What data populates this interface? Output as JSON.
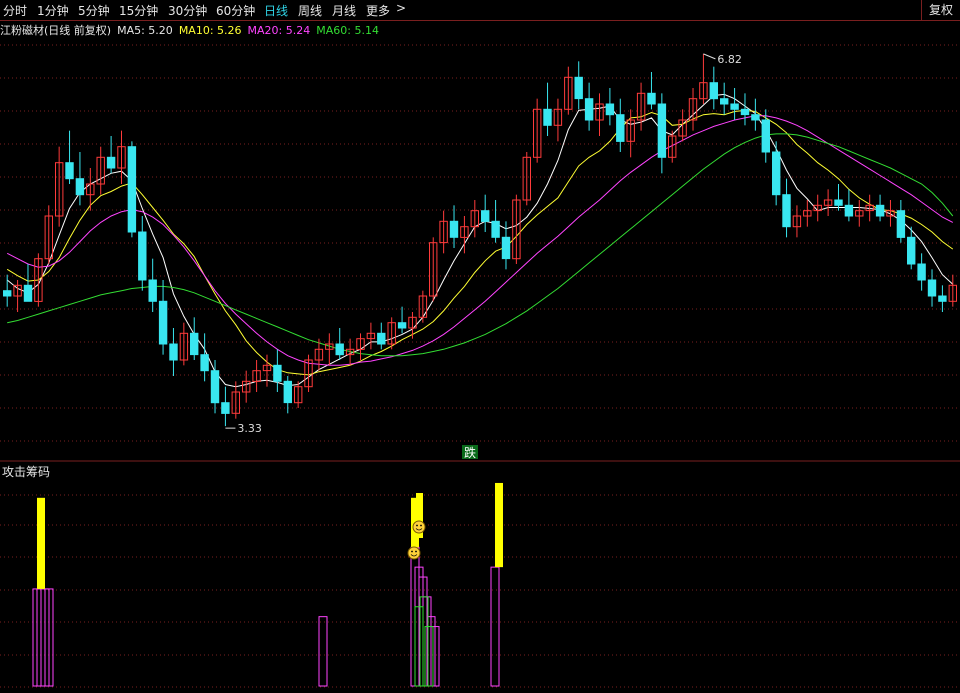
{
  "toolbar": {
    "tabs": [
      "分时",
      "1分钟",
      "5分钟",
      "15分钟",
      "30分钟",
      "60分钟",
      "日线",
      "周线",
      "月线",
      "更多"
    ],
    "active_tab": "日线",
    "more_arrow": ">",
    "restore_button": "复权"
  },
  "legend": {
    "stock_name": "江粉磁材(日线 前复权)",
    "ma5_label": "MA5: 5.20",
    "ma10_label": "MA10: 5.26",
    "ma20_label": "MA20: 5.24",
    "ma60_label": "MA60: 5.14"
  },
  "colors": {
    "up": "#ff3b3b",
    "down": "#39e6f0",
    "ma5": "#ffffff",
    "ma10": "#ffff33",
    "ma20": "#ff44ff",
    "ma60": "#33dd33",
    "grid": "#7a1f1f"
  },
  "chart_data": [
    {
      "type": "candlestick",
      "title": "江粉磁材(日线 前复权)",
      "ylim": [
        3.2,
        6.95
      ],
      "high_annotation": "6.82",
      "low_annotation": "3.33",
      "marker_label": "跌",
      "ohlc": [
        [
          4.6,
          4.75,
          4.45,
          4.55
        ],
        [
          4.55,
          4.7,
          4.4,
          4.65
        ],
        [
          4.65,
          4.85,
          4.55,
          4.5
        ],
        [
          4.5,
          4.95,
          4.45,
          4.9
        ],
        [
          4.9,
          5.4,
          4.85,
          5.3
        ],
        [
          5.3,
          5.95,
          5.2,
          5.8
        ],
        [
          5.8,
          6.1,
          5.6,
          5.65
        ],
        [
          5.65,
          5.9,
          5.4,
          5.5
        ],
        [
          5.5,
          5.75,
          5.35,
          5.6
        ],
        [
          5.6,
          5.95,
          5.5,
          5.85
        ],
        [
          5.85,
          6.05,
          5.7,
          5.75
        ],
        [
          5.75,
          6.1,
          5.6,
          5.95
        ],
        [
          5.95,
          6.0,
          5.1,
          5.15
        ],
        [
          5.15,
          5.3,
          4.6,
          4.7
        ],
        [
          4.7,
          4.9,
          4.4,
          4.5
        ],
        [
          4.5,
          4.7,
          4.0,
          4.1
        ],
        [
          4.1,
          4.25,
          3.8,
          3.95
        ],
        [
          3.95,
          4.3,
          3.9,
          4.2
        ],
        [
          4.2,
          4.35,
          3.95,
          4.0
        ],
        [
          4.0,
          4.2,
          3.75,
          3.85
        ],
        [
          3.85,
          3.95,
          3.45,
          3.55
        ],
        [
          3.55,
          3.7,
          3.33,
          3.45
        ],
        [
          3.45,
          3.75,
          3.4,
          3.65
        ],
        [
          3.65,
          3.85,
          3.55,
          3.75
        ],
        [
          3.75,
          3.95,
          3.65,
          3.85
        ],
        [
          3.85,
          4.0,
          3.7,
          3.9
        ],
        [
          3.9,
          4.05,
          3.65,
          3.75
        ],
        [
          3.75,
          3.8,
          3.45,
          3.55
        ],
        [
          3.55,
          3.75,
          3.5,
          3.7
        ],
        [
          3.7,
          4.0,
          3.65,
          3.95
        ],
        [
          3.95,
          4.15,
          3.85,
          4.05
        ],
        [
          4.05,
          4.2,
          3.9,
          4.1
        ],
        [
          4.1,
          4.25,
          3.95,
          4.0
        ],
        [
          4.0,
          4.15,
          3.9,
          4.05
        ],
        [
          4.05,
          4.2,
          3.95,
          4.15
        ],
        [
          4.15,
          4.3,
          4.05,
          4.2
        ],
        [
          4.2,
          4.3,
          4.05,
          4.1
        ],
        [
          4.1,
          4.35,
          4.05,
          4.3
        ],
        [
          4.3,
          4.45,
          4.2,
          4.25
        ],
        [
          4.25,
          4.4,
          4.15,
          4.35
        ],
        [
          4.35,
          4.6,
          4.3,
          4.55
        ],
        [
          4.55,
          5.1,
          4.5,
          5.05
        ],
        [
          5.05,
          5.35,
          4.95,
          5.25
        ],
        [
          5.25,
          5.4,
          5.0,
          5.1
        ],
        [
          5.1,
          5.3,
          4.95,
          5.2
        ],
        [
          5.2,
          5.45,
          5.1,
          5.35
        ],
        [
          5.35,
          5.5,
          5.15,
          5.25
        ],
        [
          5.25,
          5.45,
          5.05,
          5.1
        ],
        [
          5.1,
          5.25,
          4.8,
          4.9
        ],
        [
          4.9,
          5.5,
          4.85,
          5.45
        ],
        [
          5.45,
          5.9,
          5.4,
          5.85
        ],
        [
          5.85,
          6.4,
          5.8,
          6.3
        ],
        [
          6.3,
          6.55,
          6.05,
          6.15
        ],
        [
          6.15,
          6.4,
          6.0,
          6.3
        ],
        [
          6.3,
          6.7,
          6.25,
          6.6
        ],
        [
          6.6,
          6.75,
          6.3,
          6.4
        ],
        [
          6.4,
          6.55,
          6.1,
          6.2
        ],
        [
          6.2,
          6.45,
          6.05,
          6.35
        ],
        [
          6.35,
          6.5,
          6.15,
          6.25
        ],
        [
          6.25,
          6.4,
          5.9,
          6.0
        ],
        [
          6.0,
          6.3,
          5.85,
          6.2
        ],
        [
          6.2,
          6.55,
          6.1,
          6.45
        ],
        [
          6.45,
          6.65,
          6.3,
          6.35
        ],
        [
          6.35,
          6.45,
          5.7,
          5.85
        ],
        [
          5.85,
          6.1,
          5.8,
          6.05
        ],
        [
          6.05,
          6.3,
          6.0,
          6.2
        ],
        [
          6.2,
          6.5,
          6.1,
          6.4
        ],
        [
          6.4,
          6.82,
          6.35,
          6.55
        ],
        [
          6.55,
          6.7,
          6.3,
          6.4
        ],
        [
          6.4,
          6.55,
          6.25,
          6.35
        ],
        [
          6.35,
          6.5,
          6.2,
          6.3
        ],
        [
          6.3,
          6.45,
          6.15,
          6.25
        ],
        [
          6.25,
          6.4,
          6.1,
          6.2
        ],
        [
          6.2,
          6.3,
          5.8,
          5.9
        ],
        [
          5.9,
          6.0,
          5.4,
          5.5
        ],
        [
          5.5,
          5.65,
          5.1,
          5.2
        ],
        [
          5.2,
          5.4,
          5.1,
          5.3
        ],
        [
          5.3,
          5.45,
          5.2,
          5.35
        ],
        [
          5.35,
          5.5,
          5.25,
          5.4
        ],
        [
          5.4,
          5.55,
          5.3,
          5.45
        ],
        [
          5.45,
          5.6,
          5.35,
          5.4
        ],
        [
          5.4,
          5.55,
          5.25,
          5.3
        ],
        [
          5.3,
          5.45,
          5.2,
          5.35
        ],
        [
          5.35,
          5.5,
          5.25,
          5.4
        ],
        [
          5.4,
          5.5,
          5.25,
          5.3
        ],
        [
          5.3,
          5.45,
          5.2,
          5.35
        ],
        [
          5.35,
          5.45,
          5.05,
          5.1
        ],
        [
          5.1,
          5.2,
          4.8,
          4.85
        ],
        [
          4.85,
          4.95,
          4.6,
          4.7
        ],
        [
          4.7,
          4.8,
          4.45,
          4.55
        ],
        [
          4.55,
          4.65,
          4.4,
          4.5
        ],
        [
          4.5,
          4.75,
          4.45,
          4.65
        ]
      ],
      "series": [
        {
          "name": "MA5",
          "values": [
            4.7,
            4.62,
            4.58,
            4.66,
            4.86,
            5.12,
            5.37,
            5.52,
            5.6,
            5.65,
            5.7,
            5.72,
            5.63,
            5.37,
            5.13,
            4.91,
            4.57,
            4.36,
            4.19,
            4.05,
            3.84,
            3.72,
            3.7,
            3.72,
            3.75,
            3.76,
            3.74,
            3.71,
            3.72,
            3.79,
            3.86,
            3.91,
            3.96,
            4.01,
            4.05,
            4.12,
            4.12,
            4.15,
            4.19,
            4.24,
            4.35,
            4.51,
            4.7,
            4.88,
            5.04,
            5.2,
            5.25,
            5.23,
            5.18,
            5.21,
            5.29,
            5.42,
            5.6,
            5.82,
            6.11,
            6.29,
            6.3,
            6.31,
            6.33,
            6.2,
            6.16,
            6.18,
            6.22,
            6.1,
            6.06,
            6.16,
            6.25,
            6.34,
            6.43,
            6.44,
            6.4,
            6.33,
            6.26,
            6.11,
            5.93,
            5.73,
            5.56,
            5.46,
            5.35,
            5.38,
            5.38,
            5.38,
            5.38,
            5.37,
            5.36,
            5.32,
            5.26,
            5.17,
            5.06,
            4.91,
            4.75,
            4.66
          ]
        },
        {
          "name": "MA10",
          "values": [
            4.8,
            4.74,
            4.69,
            4.7,
            4.78,
            4.91,
            5.09,
            5.26,
            5.4,
            5.49,
            5.53,
            5.58,
            5.61,
            5.5,
            5.38,
            5.26,
            5.13,
            5.04,
            4.92,
            4.74,
            4.57,
            4.41,
            4.28,
            4.13,
            4.02,
            3.93,
            3.86,
            3.83,
            3.82,
            3.81,
            3.84,
            3.86,
            3.88,
            3.9,
            3.94,
            3.99,
            4.03,
            4.08,
            4.14,
            4.19,
            4.24,
            4.31,
            4.41,
            4.53,
            4.64,
            4.77,
            4.88,
            4.97,
            5.01,
            5.11,
            5.22,
            5.31,
            5.39,
            5.47,
            5.62,
            5.77,
            5.85,
            5.91,
            6.0,
            6.12,
            6.22,
            6.23,
            6.27,
            6.24,
            6.15,
            6.16,
            6.21,
            6.25,
            6.26,
            6.25,
            6.28,
            6.29,
            6.28,
            6.22,
            6.16,
            6.08,
            5.97,
            5.89,
            5.8,
            5.73,
            5.65,
            5.55,
            5.47,
            5.41,
            5.36,
            5.35,
            5.32,
            5.28,
            5.22,
            5.15,
            5.06,
            4.99
          ]
        },
        {
          "name": "MA20",
          "values": [
            4.95,
            4.9,
            4.85,
            4.82,
            4.83,
            4.88,
            4.96,
            5.06,
            5.16,
            5.24,
            5.3,
            5.34,
            5.36,
            5.34,
            5.29,
            5.22,
            5.12,
            5.01,
            4.88,
            4.74,
            4.6,
            4.48,
            4.38,
            4.29,
            4.2,
            4.12,
            4.05,
            3.99,
            3.95,
            3.92,
            3.91,
            3.9,
            3.9,
            3.91,
            3.93,
            3.94,
            3.96,
            3.98,
            4.01,
            4.04,
            4.08,
            4.13,
            4.19,
            4.26,
            4.34,
            4.42,
            4.5,
            4.59,
            4.68,
            4.77,
            4.86,
            4.95,
            5.03,
            5.11,
            5.2,
            5.29,
            5.37,
            5.45,
            5.54,
            5.63,
            5.71,
            5.78,
            5.85,
            5.91,
            5.96,
            6.01,
            6.06,
            6.1,
            6.14,
            6.17,
            6.2,
            6.22,
            6.24,
            6.24,
            6.22,
            6.19,
            6.15,
            6.1,
            6.04,
            5.98,
            5.92,
            5.86,
            5.8,
            5.74,
            5.68,
            5.62,
            5.56,
            5.5,
            5.43,
            5.36,
            5.29,
            5.24
          ]
        },
        {
          "name": "MA60",
          "values": [
            4.3,
            4.32,
            4.35,
            4.38,
            4.41,
            4.44,
            4.47,
            4.5,
            4.53,
            4.56,
            4.58,
            4.6,
            4.62,
            4.63,
            4.64,
            4.64,
            4.63,
            4.61,
            4.58,
            4.54,
            4.5,
            4.46,
            4.42,
            4.38,
            4.34,
            4.3,
            4.26,
            4.22,
            4.18,
            4.14,
            4.11,
            4.08,
            4.05,
            4.03,
            4.01,
            4.0,
            3.99,
            3.99,
            3.99,
            4.0,
            4.01,
            4.03,
            4.05,
            4.08,
            4.11,
            4.15,
            4.19,
            4.24,
            4.29,
            4.35,
            4.41,
            4.48,
            4.55,
            4.62,
            4.7,
            4.78,
            4.86,
            4.94,
            5.02,
            5.1,
            5.18,
            5.26,
            5.34,
            5.42,
            5.5,
            5.58,
            5.66,
            5.74,
            5.81,
            5.88,
            5.94,
            5.99,
            6.03,
            6.06,
            6.07,
            6.07,
            6.06,
            6.04,
            6.01,
            5.98,
            5.95,
            5.91,
            5.87,
            5.83,
            5.79,
            5.75,
            5.7,
            5.65,
            5.6,
            5.52,
            5.42,
            5.3
          ]
        }
      ]
    },
    {
      "type": "bar",
      "title": "攻击筹码",
      "groups": [
        {
          "magenta": [
            98,
            98,
            98,
            98
          ],
          "yellow": [
            190,
            0,
            0,
            0
          ],
          "green": [
            0,
            0,
            0,
            0
          ]
        },
        {
          "magenta": [
            70
          ],
          "yellow": [
            0
          ],
          "green": [
            0
          ]
        },
        {
          "magenta": [
            140,
            120,
            110,
            90,
            70,
            60
          ],
          "yellow": [
            190,
            0,
            0,
            0,
            0,
            0
          ],
          "green": [
            80,
            90,
            60,
            0,
            0,
            0
          ]
        },
        {
          "magenta": [
            120
          ],
          "yellow": [
            205
          ],
          "green": [
            0
          ]
        }
      ],
      "smiley_count": 2
    }
  ]
}
